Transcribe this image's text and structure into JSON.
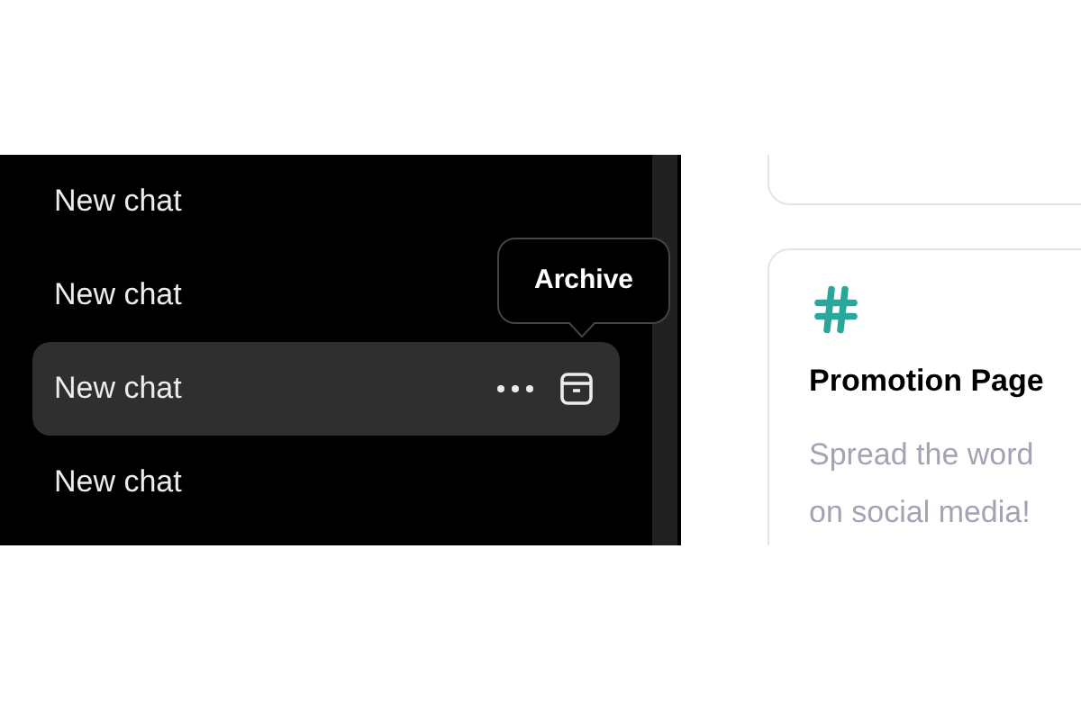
{
  "sidebar": {
    "items": [
      {
        "title": "New chat",
        "selected": false
      },
      {
        "title": "New chat",
        "selected": false
      },
      {
        "title": "New chat",
        "selected": true
      },
      {
        "title": "New chat",
        "selected": false
      }
    ],
    "tooltip": "Archive"
  },
  "cards": [
    {
      "title": "Promotion Page",
      "description_lines": [
        "Spread the word",
        "on social media!"
      ]
    }
  ]
}
